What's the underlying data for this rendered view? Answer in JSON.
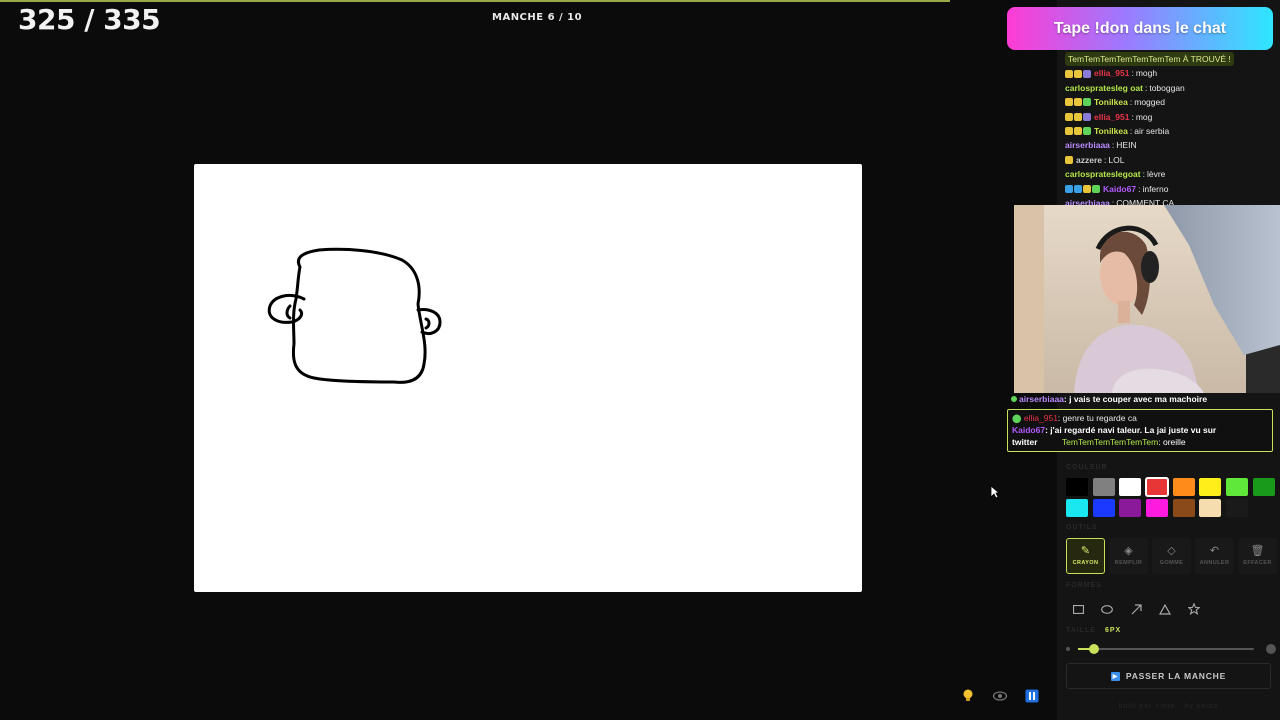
{
  "game": {
    "score": "325 / 335",
    "round": "MANCHE 6 / 10"
  },
  "donate_banner": "Tape !don dans le chat",
  "chat": {
    "first_line": "TemTemTemTemTemTemTem  À TROUVÉ !",
    "messages": [
      {
        "user": "ellia_951",
        "color": "#e8334a",
        "badges": [
          "#e8c53a",
          "#e8c53a",
          "#8a7bd8"
        ],
        "text": "mogh"
      },
      {
        "user": "carlospratesleg oat",
        "display": "carlosprateslegoat",
        "color": "#b4e64a",
        "badges": [],
        "text": "toboggan"
      },
      {
        "user": "Tonilkea",
        "color": "#c9e04a",
        "badges": [
          "#e8c53a",
          "#e8c53a",
          "#5fd35a"
        ],
        "text": "mogged"
      },
      {
        "user": "ellia_951",
        "color": "#e8334a",
        "badges": [
          "#e8c53a",
          "#e8c53a",
          "#8a7bd8"
        ],
        "text": "mog"
      },
      {
        "user": "Tonilkea",
        "color": "#c9e04a",
        "badges": [
          "#e8c53a",
          "#e8c53a",
          "#5fd35a"
        ],
        "text": "air serbia"
      },
      {
        "user": "airserbiaaa",
        "color": "#b98aff",
        "badges": [],
        "text": "HEIN"
      },
      {
        "user": "azzere",
        "color": "#c9c9c9",
        "badges": [
          "#e8c53a"
        ],
        "text": "LOL"
      },
      {
        "user": "carlosprateslegoat",
        "color": "#b4e64a",
        "badges": [],
        "text": "lèvre"
      },
      {
        "user": "Kaido67",
        "color": "#b25bff",
        "badges": [
          "#3aa0e8",
          "#3aa0e8",
          "#e8c53a",
          "#5fd35a"
        ],
        "text": "inferno"
      },
      {
        "user": "airserbiaaa",
        "color": "#b98aff",
        "badges": [],
        "text": "COMMENT ÇA"
      }
    ]
  },
  "overlay_chat": {
    "top_user": "airserbiaaa",
    "top_text": "j vais te couper avec ma machoire",
    "line1_user": "ellia_951",
    "line1_text": "genre tu regarde ca",
    "line2_user": "Kaido67",
    "line2_text": "j'ai regardé navi taleur. La jai juste vu sur",
    "line2b_text": "twitter",
    "line3_user": "TemTemTemTemTemTem",
    "line3_text": "oreille"
  },
  "tools_panel": {
    "colors_label": "COULEUR",
    "colors": [
      "#000000",
      "#808080",
      "#ffffff",
      "#e83535",
      "#ff8c1a",
      "#ffee1a",
      "#5fe83a",
      "#1a9a1a",
      "#1ae8f0",
      "#1a3aff",
      "#8a1a9a",
      "#ff1ae0",
      "#8a4a1a",
      "#f5ddb0"
    ],
    "selected_color": "#e83535",
    "tools_label": "OUTILS",
    "tools": [
      {
        "label": "CRAYON",
        "icon": "pencil-icon",
        "active": true
      },
      {
        "label": "REMPLIR",
        "icon": "fill-bucket-icon",
        "active": false
      },
      {
        "label": "GOMME",
        "icon": "eraser-icon",
        "active": false
      },
      {
        "label": "ANNULER",
        "icon": "undo-icon",
        "active": false
      },
      {
        "label": "EFFACER",
        "icon": "trash-icon",
        "active": false
      }
    ],
    "shapes_label": "FORMES",
    "shapes": [
      "rectangle-icon",
      "ellipse-icon",
      "arrow-icon",
      "triangle-icon",
      "star-icon"
    ],
    "size_label": "TAILLE",
    "size_value": "6PX",
    "size_fraction": 0.09,
    "skip_label": "PASSER LA MANCHE",
    "footer": "built par ninja · by kaido"
  },
  "accent": "#c8e05a"
}
